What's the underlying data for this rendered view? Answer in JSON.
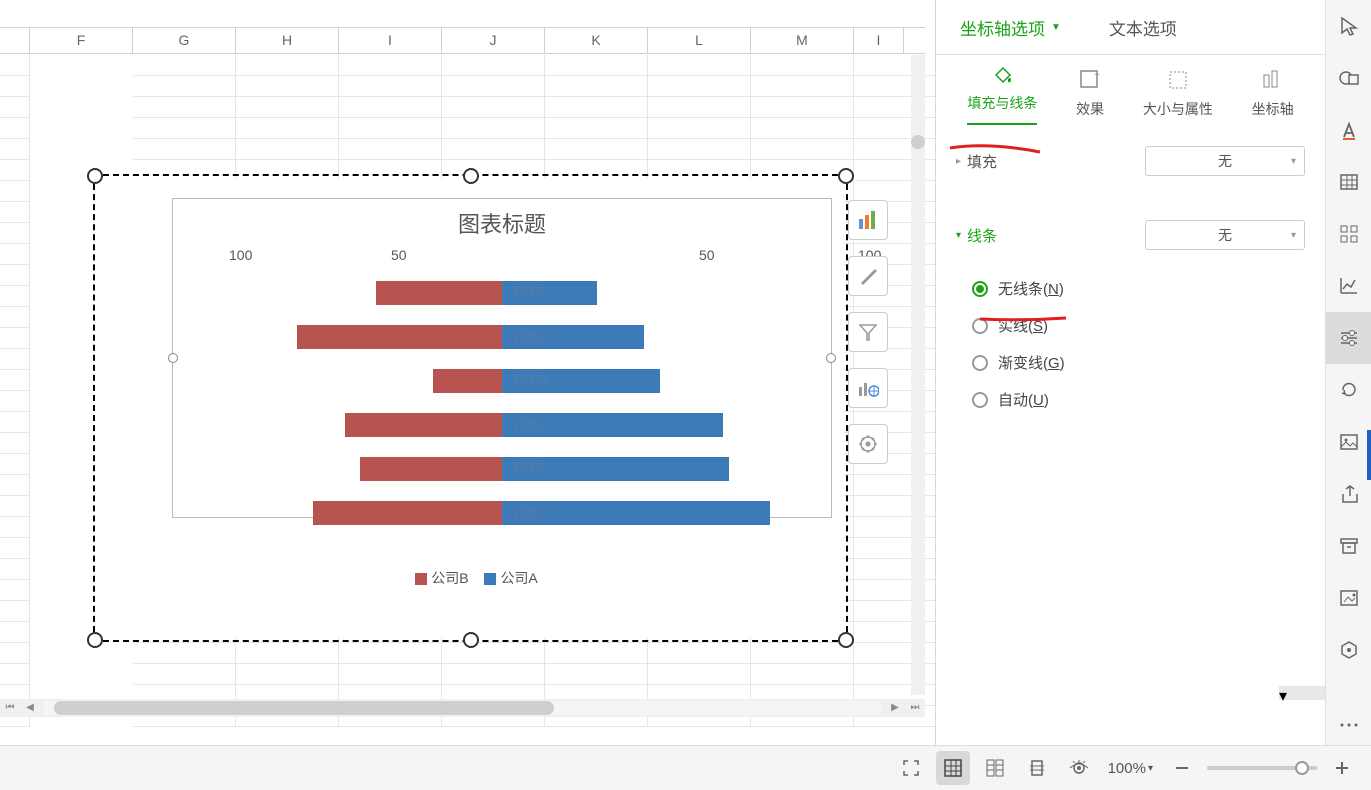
{
  "columns": [
    "F",
    "G",
    "H",
    "I",
    "J",
    "K",
    "L",
    "M",
    "I"
  ],
  "chart_data": {
    "type": "bar",
    "title": "图表标题",
    "categories": [
      "指标6",
      "指标5",
      "指标4",
      "指标3",
      "指标2",
      "指标1"
    ],
    "axis_ticks": [
      "100",
      "50",
      "",
      "50",
      "100"
    ],
    "series": [
      {
        "name": "公司B",
        "color": "#b85450",
        "values": [
          -40,
          -65,
          -22,
          -50,
          -45,
          -60
        ]
      },
      {
        "name": "公司A",
        "color": "#3d7bb8",
        "values": [
          30,
          45,
          50,
          70,
          72,
          85
        ]
      }
    ],
    "legend": [
      "公司B",
      "公司A"
    ]
  },
  "props_panel": {
    "top_tabs": {
      "axis_options": "坐标轴选项",
      "text_options": "文本选项"
    },
    "sub_tabs": {
      "fill_line": "填充与线条",
      "effect": "效果",
      "size_prop": "大小与属性",
      "axis": "坐标轴"
    },
    "fill": {
      "label": "填充",
      "value": "无"
    },
    "line": {
      "label": "线条",
      "value": "无",
      "options": {
        "none": {
          "pre": "无线条(",
          "key": "N",
          "post": ")"
        },
        "solid": {
          "pre": "实线(",
          "key": "S",
          "post": ")"
        },
        "gradient": {
          "pre": "渐变线(",
          "key": "G",
          "post": ")"
        },
        "auto": {
          "pre": "自动(",
          "key": "U",
          "post": ")"
        }
      }
    }
  },
  "statusbar": {
    "zoom": "100%"
  }
}
